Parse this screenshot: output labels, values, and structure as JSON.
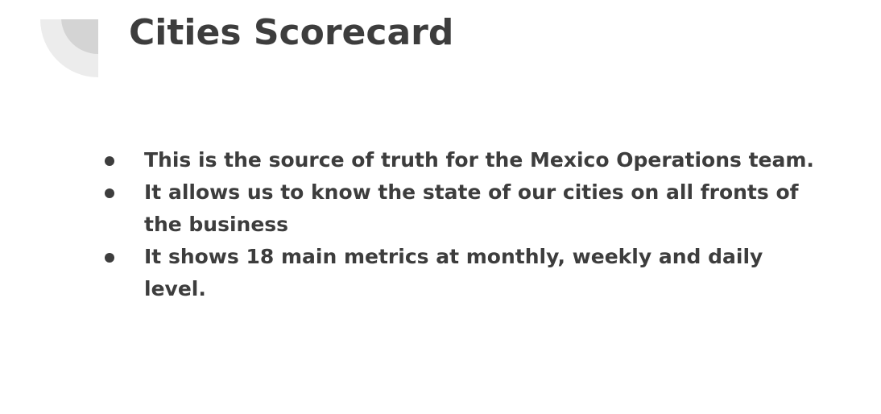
{
  "slide": {
    "title": "Cities Scorecard",
    "bullets": [
      {
        "text": "This is the source of truth for the Mexico Operations team."
      },
      {
        "text": "It allows us to know the state of our cities on all fronts of the business"
      },
      {
        "text": "It shows 18 main metrics at monthly, weekly and daily level."
      }
    ]
  },
  "colors": {
    "text": "#3d3d3d",
    "decoration_light": "#ececec",
    "decoration_dark": "#d4d4d4",
    "background": "#ffffff"
  },
  "icons": {
    "corner_decoration": "quarter-circle-decoration-icon",
    "bullet": "bullet-dot-icon"
  }
}
